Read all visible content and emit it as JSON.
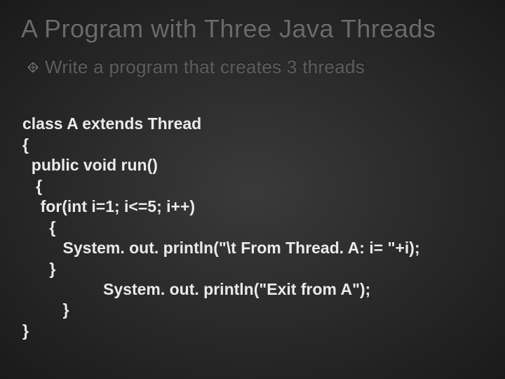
{
  "title": "A Program with Three Java Threads",
  "bullet": "Write a program that creates 3 threads",
  "code": {
    "l1": "class A extends Thread",
    "l2": "{",
    "l3": "  public void run()",
    "l4": "   {",
    "l5": "    for(int i=1; i<=5; i++)",
    "l6": "      {",
    "l7": "         System. out. println(\"\\t From Thread. A: i= \"+i);",
    "l8": "      }",
    "l9": "                  System. out. println(\"Exit from A\");",
    "l10": "         }",
    "l11": "}"
  }
}
